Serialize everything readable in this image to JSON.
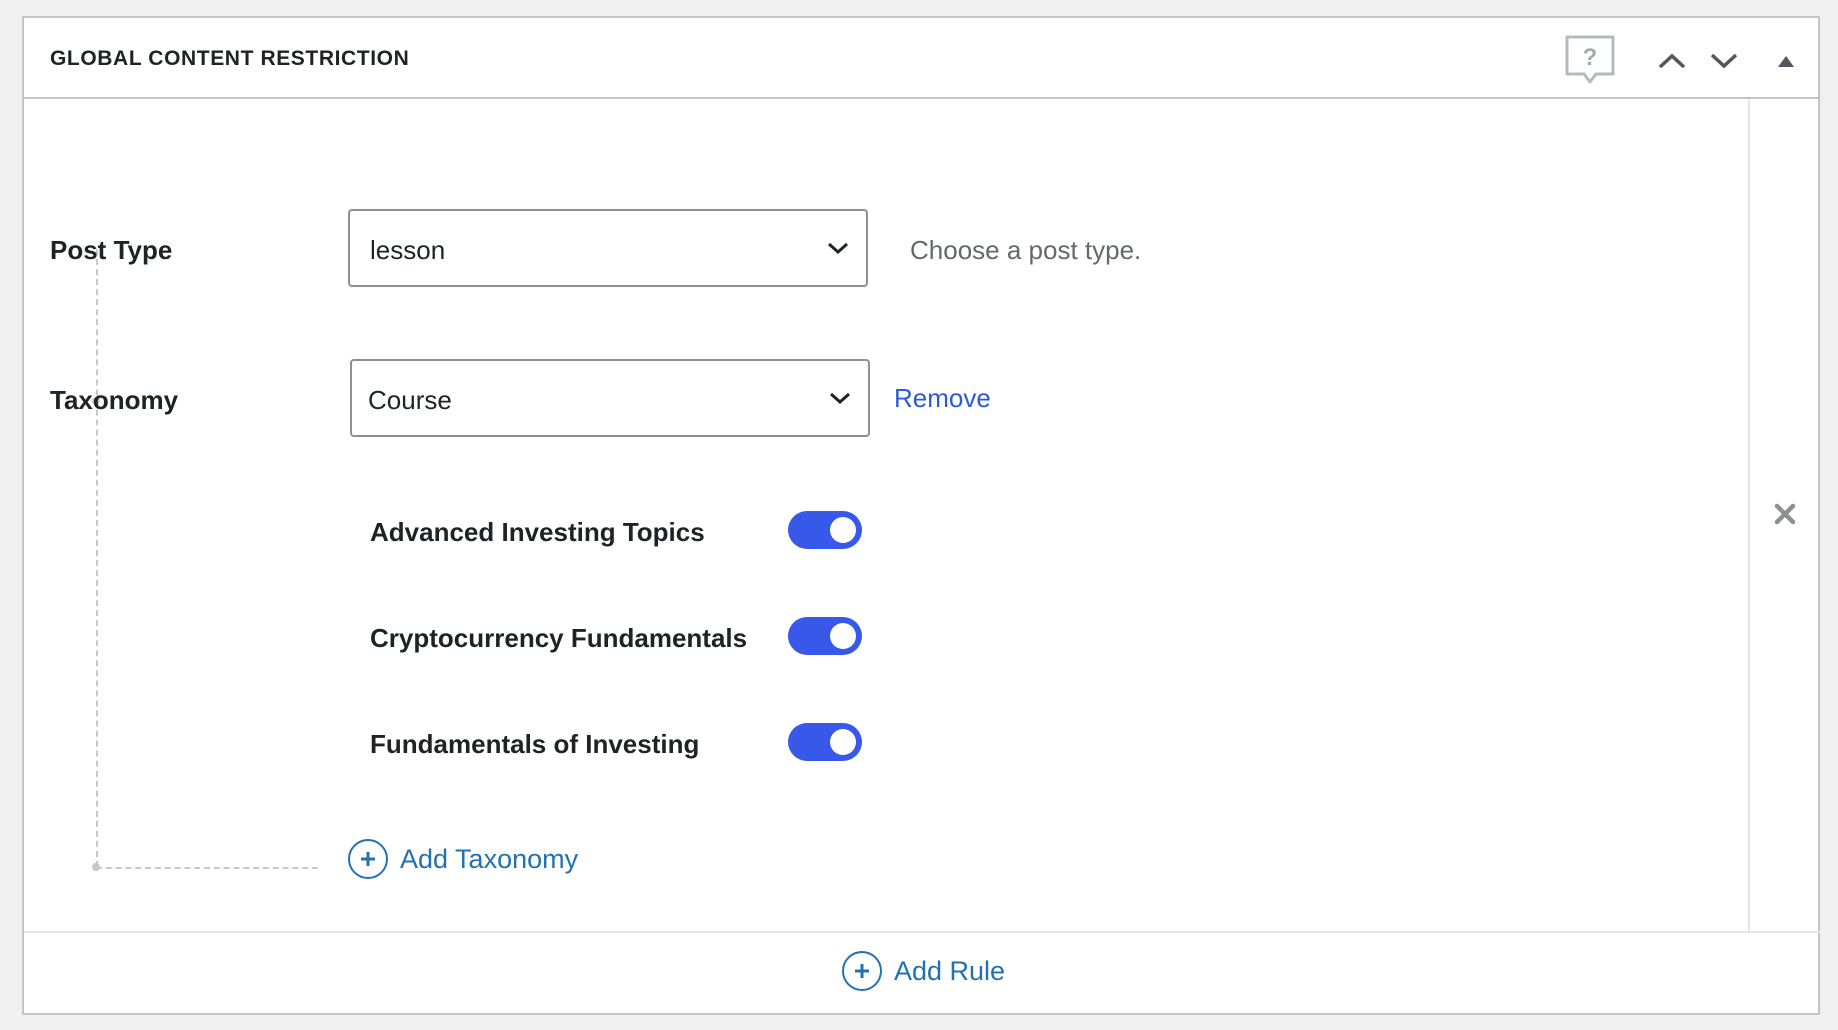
{
  "panel": {
    "title": "GLOBAL CONTENT RESTRICTION",
    "help_icon": "help-bubble-icon",
    "move_up_icon": "chevron-up-icon",
    "move_down_icon": "chevron-down-icon",
    "toggle_icon": "triangle-up-icon"
  },
  "rule": {
    "post_type": {
      "label": "Post Type",
      "selected": "lesson",
      "help": "Choose a post type."
    },
    "taxonomy": {
      "label": "Taxonomy",
      "selected": "Course",
      "remove_label": "Remove",
      "terms": [
        {
          "label": "Advanced Investing Topics",
          "enabled": true
        },
        {
          "label": "Cryptocurrency Fundamentals",
          "enabled": true
        },
        {
          "label": "Fundamentals of Investing",
          "enabled": true
        }
      ]
    },
    "add_taxonomy_label": "Add Taxonomy",
    "remove_rule_icon": "close-icon"
  },
  "footer": {
    "add_rule_label": "Add Rule"
  },
  "colors": {
    "accent": "#3858e9",
    "link": "#2271b1",
    "remove_link": "#2c5ad8",
    "border": "#c3c4c7"
  }
}
